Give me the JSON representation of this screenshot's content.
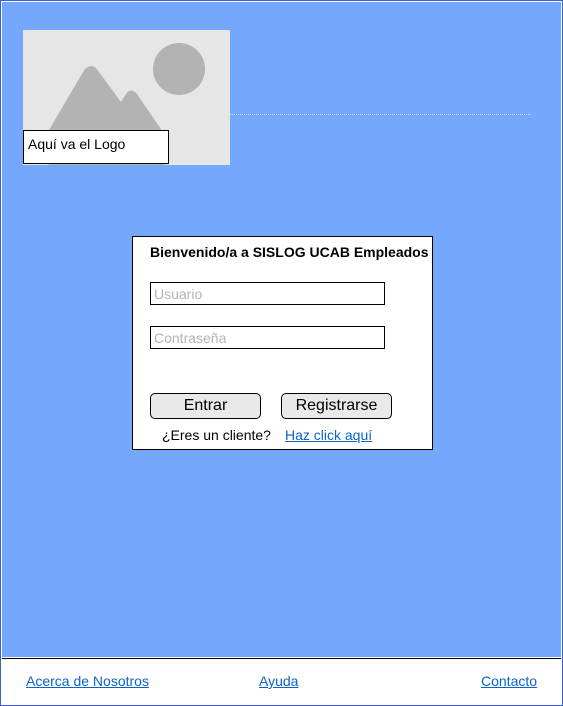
{
  "header": {
    "logo_caption": "Aquí va el Logo"
  },
  "login": {
    "title": "Bienvenido/a a SISLOG UCAB Empleados",
    "username_placeholder": "Usuario",
    "password_placeholder": "Contraseña",
    "login_button": "Entrar",
    "register_button": "Registrarse",
    "client_question": "¿Eres un cliente?",
    "client_link": "Haz click aquí"
  },
  "footer": {
    "links": [
      "Acerca de Nosotros",
      "Ayuda",
      "Contacto"
    ]
  },
  "colors": {
    "background": "#75a8fc",
    "link": "#0b63c9",
    "placeholder_image": "#e6e6e6",
    "placeholder_shapes": "#b3b3b3"
  }
}
